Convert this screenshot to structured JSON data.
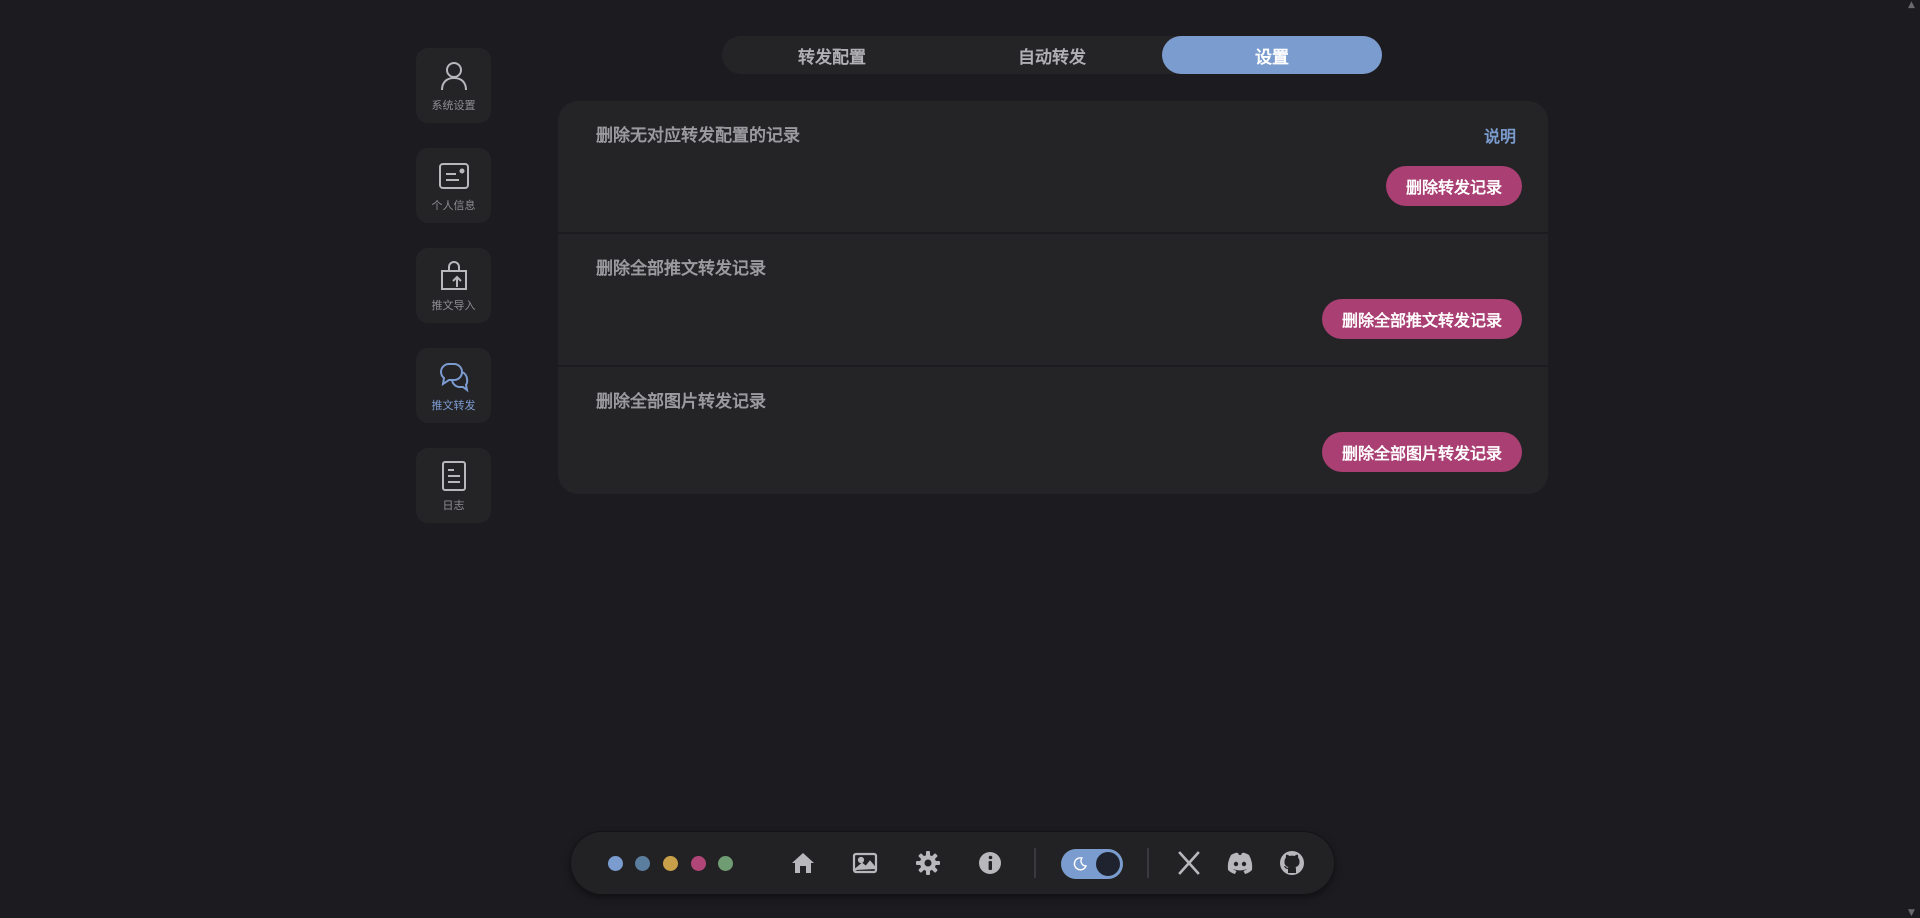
{
  "sidebar": {
    "items": [
      {
        "label": "系统设置",
        "icon": "user-icon"
      },
      {
        "label": "个人信息",
        "icon": "id-card-icon"
      },
      {
        "label": "推文导入",
        "icon": "bag-upload-icon"
      },
      {
        "label": "推文转发",
        "icon": "chat-bubbles-icon",
        "active": true
      },
      {
        "label": "日志",
        "icon": "document-icon"
      }
    ]
  },
  "tabs": [
    {
      "label": "转发配置"
    },
    {
      "label": "自动转发"
    },
    {
      "label": "设置",
      "active": true
    }
  ],
  "panel": {
    "rows": [
      {
        "title": "删除无对应转发配置的记录",
        "link": "说明",
        "button": "删除转发记录"
      },
      {
        "title": "删除全部推文转发记录",
        "button": "删除全部推文转发记录"
      },
      {
        "title": "删除全部图片转发记录",
        "button": "删除全部图片转发记录"
      }
    ]
  },
  "bottombar": {
    "theme_dots": [
      "#7b9ccf",
      "#5b7d9e",
      "#c9a04a",
      "#b04577",
      "#6f9c72"
    ],
    "nav_icons": [
      "home-icon",
      "image-icon",
      "gear-icon",
      "info-icon"
    ],
    "theme_toggle": "dark",
    "social_icons": [
      "x-twitter-icon",
      "discord-icon",
      "github-icon"
    ]
  },
  "colors": {
    "background": "#1c1c20",
    "panel": "#242426",
    "accent": "#7b9ccf",
    "danger": "#a93f72"
  }
}
